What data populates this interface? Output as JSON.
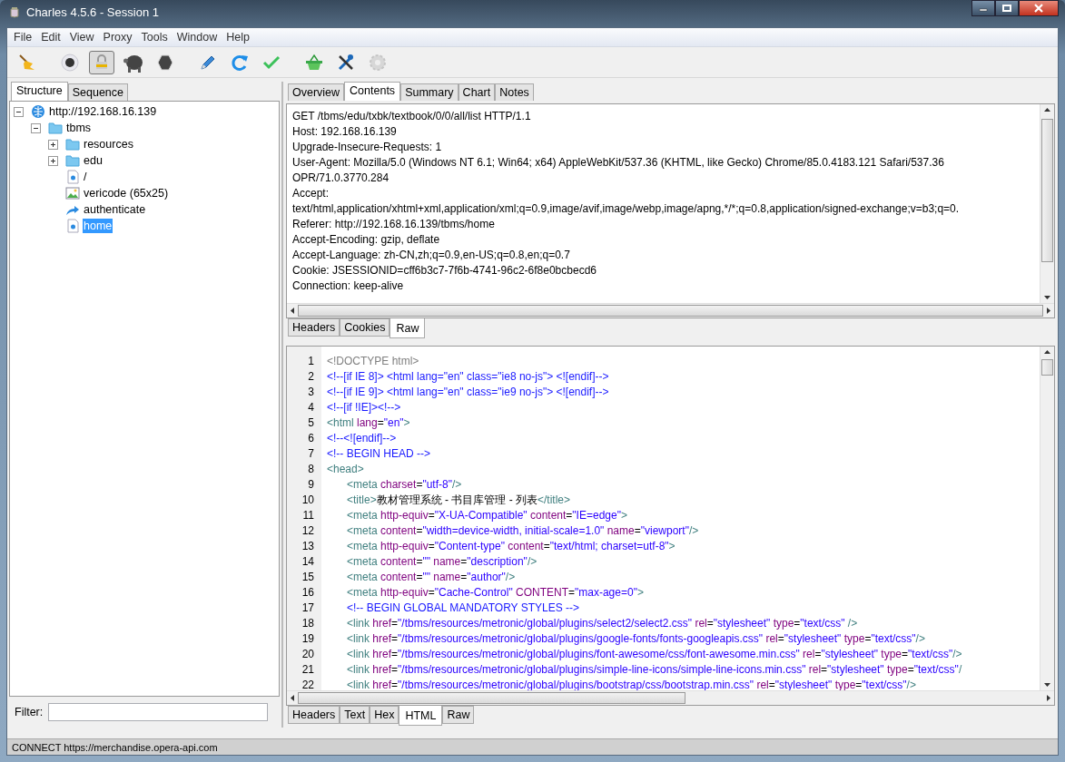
{
  "window": {
    "title": "Charles 4.5.6 - Session 1"
  },
  "menu": [
    "File",
    "Edit",
    "View",
    "Proxy",
    "Tools",
    "Window",
    "Help"
  ],
  "toolbar": [
    {
      "kind": "broom",
      "pressed": false,
      "disabled": false
    },
    {
      "kind": "record",
      "pressed": false,
      "disabled": false
    },
    {
      "kind": "lock",
      "pressed": true,
      "disabled": false
    },
    {
      "kind": "turtle",
      "pressed": false,
      "disabled": false
    },
    {
      "kind": "stop",
      "pressed": false,
      "disabled": false
    },
    {
      "kind": "pen",
      "pressed": false,
      "disabled": false
    },
    {
      "kind": "refresh",
      "pressed": false,
      "disabled": false
    },
    {
      "kind": "check",
      "pressed": false,
      "disabled": false
    },
    {
      "kind": "basket",
      "pressed": false,
      "disabled": false
    },
    {
      "kind": "tools",
      "pressed": false,
      "disabled": false
    },
    {
      "kind": "gear",
      "pressed": false,
      "disabled": true
    }
  ],
  "sidebar": {
    "tabs": [
      {
        "label": "Structure",
        "selected": true
      },
      {
        "label": "Sequence",
        "selected": false
      }
    ],
    "tree": [
      {
        "label": "http://192.168.16.139",
        "kind": "globe",
        "expanded": true,
        "selected": false,
        "children": [
          {
            "label": "tbms",
            "kind": "folder",
            "expanded": true,
            "selected": false,
            "children": [
              {
                "label": "resources",
                "kind": "folder",
                "expanded": false,
                "selected": false
              },
              {
                "label": "edu",
                "kind": "folder",
                "expanded": false,
                "selected": false
              },
              {
                "label": "/",
                "kind": "page",
                "selected": false
              },
              {
                "label": "vericode (65x25)",
                "kind": "image",
                "selected": false
              },
              {
                "label": "authenticate",
                "kind": "redirect",
                "selected": false
              },
              {
                "label": "home",
                "kind": "page",
                "selected": true
              }
            ]
          }
        ]
      }
    ],
    "filter": {
      "label": "Filter:"
    }
  },
  "detail": {
    "tabs": [
      {
        "label": "Overview",
        "selected": false
      },
      {
        "label": "Contents",
        "selected": true
      },
      {
        "label": "Summary",
        "selected": false
      },
      {
        "label": "Chart",
        "selected": false
      },
      {
        "label": "Notes",
        "selected": false
      }
    ],
    "request": {
      "lines": [
        "GET /tbms/edu/txbk/textbook/0/0/all/list HTTP/1.1",
        "Host: 192.168.16.139",
        "Upgrade-Insecure-Requests: 1",
        "User-Agent: Mozilla/5.0 (Windows NT 6.1; Win64; x64) AppleWebKit/537.36 (KHTML, like Gecko) Chrome/85.0.4183.121 Safari/537.36",
        "OPR/71.0.3770.284",
        "Accept:",
        "text/html,application/xhtml+xml,application/xml;q=0.9,image/avif,image/webp,image/apng,*/*;q=0.8,application/signed-exchange;v=b3;q=0.",
        "Referer: http://192.168.16.139/tbms/home",
        "Accept-Encoding: gzip, deflate",
        "Accept-Language: zh-CN,zh;q=0.9,en-US;q=0.8,en;q=0.7",
        "Cookie: JSESSIONID=cff6b3c7-7f6b-4741-96c2-6f8e0bcbecd6",
        "Connection: keep-alive"
      ],
      "tabs": [
        {
          "label": "Headers",
          "selected": false
        },
        {
          "label": "Cookies",
          "selected": false
        },
        {
          "label": "Raw",
          "selected": true
        }
      ]
    },
    "response": {
      "lines": [
        {
          "number": "1",
          "indent": false,
          "tokens": [
            {
              "kind": "doctype",
              "text": "<!DOCTYPE html>"
            }
          ]
        },
        {
          "number": "2",
          "indent": false,
          "tokens": [
            {
              "kind": "comment",
              "text": "<!--[if IE 8]> <html lang=\"en\" class=\"ie8 no-js\"> <![endif]-->"
            }
          ]
        },
        {
          "number": "3",
          "indent": false,
          "tokens": [
            {
              "kind": "comment",
              "text": "<!--[if IE 9]> <html lang=\"en\" class=\"ie9 no-js\"> <![endif]-->"
            }
          ]
        },
        {
          "number": "4",
          "indent": false,
          "tokens": [
            {
              "kind": "comment",
              "text": "<!--[if !IE]><!-->"
            }
          ]
        },
        {
          "number": "5",
          "indent": false,
          "tokens": [
            {
              "kind": "tag",
              "text": "<html"
            },
            {
              "kind": "attr",
              "text": " lang"
            },
            {
              "kind": "plain",
              "text": "="
            },
            {
              "kind": "value",
              "text": "\"en\""
            },
            {
              "kind": "tag",
              "text": ">"
            }
          ]
        },
        {
          "number": "6",
          "indent": false,
          "tokens": [
            {
              "kind": "comment",
              "text": "<!--<![endif]-->"
            }
          ]
        },
        {
          "number": "7",
          "indent": false,
          "tokens": [
            {
              "kind": "comment",
              "text": "<!-- BEGIN HEAD -->"
            }
          ]
        },
        {
          "number": "8",
          "indent": false,
          "tokens": [
            {
              "kind": "tag",
              "text": "<head>"
            }
          ]
        },
        {
          "number": "9",
          "indent": true,
          "tokens": [
            {
              "kind": "tag",
              "text": "<meta"
            },
            {
              "kind": "attr",
              "text": " charset"
            },
            {
              "kind": "plain",
              "text": "="
            },
            {
              "kind": "value",
              "text": "\"utf-8\""
            },
            {
              "kind": "tag",
              "text": "/>"
            }
          ]
        },
        {
          "number": "10",
          "indent": true,
          "tokens": [
            {
              "kind": "tag",
              "text": "<title>"
            },
            {
              "kind": "plain",
              "text": "教材管理系统 - 书目库管理 - 列表"
            },
            {
              "kind": "tag",
              "text": "</title>"
            }
          ]
        },
        {
          "number": "11",
          "indent": true,
          "tokens": [
            {
              "kind": "tag",
              "text": "<meta"
            },
            {
              "kind": "attr",
              "text": " http-equiv"
            },
            {
              "kind": "plain",
              "text": "="
            },
            {
              "kind": "value",
              "text": "\"X-UA-Compatible\""
            },
            {
              "kind": "attr",
              "text": " content"
            },
            {
              "kind": "plain",
              "text": "="
            },
            {
              "kind": "value",
              "text": "\"IE=edge\""
            },
            {
              "kind": "tag",
              "text": ">"
            }
          ]
        },
        {
          "number": "12",
          "indent": true,
          "tokens": [
            {
              "kind": "tag",
              "text": "<meta"
            },
            {
              "kind": "attr",
              "text": " content"
            },
            {
              "kind": "plain",
              "text": "="
            },
            {
              "kind": "value",
              "text": "\"width=device-width, initial-scale=1.0\""
            },
            {
              "kind": "attr",
              "text": " name"
            },
            {
              "kind": "plain",
              "text": "="
            },
            {
              "kind": "value",
              "text": "\"viewport\""
            },
            {
              "kind": "tag",
              "text": "/>"
            }
          ]
        },
        {
          "number": "13",
          "indent": true,
          "tokens": [
            {
              "kind": "tag",
              "text": "<meta"
            },
            {
              "kind": "attr",
              "text": " http-equiv"
            },
            {
              "kind": "plain",
              "text": "="
            },
            {
              "kind": "value",
              "text": "\"Content-type\""
            },
            {
              "kind": "attr",
              "text": " content"
            },
            {
              "kind": "plain",
              "text": "="
            },
            {
              "kind": "value",
              "text": "\"text/html; charset=utf-8\""
            },
            {
              "kind": "tag",
              "text": ">"
            }
          ]
        },
        {
          "number": "14",
          "indent": true,
          "tokens": [
            {
              "kind": "tag",
              "text": "<meta"
            },
            {
              "kind": "attr",
              "text": " content"
            },
            {
              "kind": "plain",
              "text": "="
            },
            {
              "kind": "value",
              "text": "\"\""
            },
            {
              "kind": "attr",
              "text": " name"
            },
            {
              "kind": "plain",
              "text": "="
            },
            {
              "kind": "value",
              "text": "\"description\""
            },
            {
              "kind": "tag",
              "text": "/>"
            }
          ]
        },
        {
          "number": "15",
          "indent": true,
          "tokens": [
            {
              "kind": "tag",
              "text": "<meta"
            },
            {
              "kind": "attr",
              "text": " content"
            },
            {
              "kind": "plain",
              "text": "="
            },
            {
              "kind": "value",
              "text": "\"\""
            },
            {
              "kind": "attr",
              "text": " name"
            },
            {
              "kind": "plain",
              "text": "="
            },
            {
              "kind": "value",
              "text": "\"author\""
            },
            {
              "kind": "tag",
              "text": "/>"
            }
          ]
        },
        {
          "number": "16",
          "indent": true,
          "tokens": [
            {
              "kind": "tag",
              "text": "<meta"
            },
            {
              "kind": "attr",
              "text": " http-equiv"
            },
            {
              "kind": "plain",
              "text": "="
            },
            {
              "kind": "value",
              "text": "\"Cache-Control\""
            },
            {
              "kind": "attr",
              "text": " CONTENT"
            },
            {
              "kind": "plain",
              "text": "="
            },
            {
              "kind": "value",
              "text": "\"max-age=0\""
            },
            {
              "kind": "tag",
              "text": ">"
            }
          ]
        },
        {
          "number": "17",
          "indent": true,
          "tokens": [
            {
              "kind": "comment",
              "text": "<!-- BEGIN GLOBAL MANDATORY STYLES -->"
            }
          ]
        },
        {
          "number": "18",
          "indent": true,
          "tokens": [
            {
              "kind": "tag",
              "text": "<link"
            },
            {
              "kind": "attr",
              "text": " href"
            },
            {
              "kind": "plain",
              "text": "="
            },
            {
              "kind": "value",
              "text": "\"/tbms/resources/metronic/global/plugins/select2/select2.css\""
            },
            {
              "kind": "attr",
              "text": " rel"
            },
            {
              "kind": "plain",
              "text": "="
            },
            {
              "kind": "value",
              "text": "\"stylesheet\""
            },
            {
              "kind": "attr",
              "text": " type"
            },
            {
              "kind": "plain",
              "text": "="
            },
            {
              "kind": "value",
              "text": "\"text/css\""
            },
            {
              "kind": "tag",
              "text": " />"
            }
          ]
        },
        {
          "number": "19",
          "indent": true,
          "tokens": [
            {
              "kind": "tag",
              "text": "<link"
            },
            {
              "kind": "attr",
              "text": " href"
            },
            {
              "kind": "plain",
              "text": "="
            },
            {
              "kind": "value",
              "text": "\"/tbms/resources/metronic/global/plugins/google-fonts/fonts-googleapis.css\""
            },
            {
              "kind": "attr",
              "text": " rel"
            },
            {
              "kind": "plain",
              "text": "="
            },
            {
              "kind": "value",
              "text": "\"stylesheet\""
            },
            {
              "kind": "attr",
              "text": " type"
            },
            {
              "kind": "plain",
              "text": "="
            },
            {
              "kind": "value",
              "text": "\"text/css\""
            },
            {
              "kind": "tag",
              "text": "/>"
            }
          ]
        },
        {
          "number": "20",
          "indent": true,
          "tokens": [
            {
              "kind": "tag",
              "text": "<link"
            },
            {
              "kind": "attr",
              "text": " href"
            },
            {
              "kind": "plain",
              "text": "="
            },
            {
              "kind": "value",
              "text": "\"/tbms/resources/metronic/global/plugins/font-awesome/css/font-awesome.min.css\""
            },
            {
              "kind": "attr",
              "text": " rel"
            },
            {
              "kind": "plain",
              "text": "="
            },
            {
              "kind": "value",
              "text": "\"stylesheet\""
            },
            {
              "kind": "attr",
              "text": " type"
            },
            {
              "kind": "plain",
              "text": "="
            },
            {
              "kind": "value",
              "text": "\"text/css\""
            },
            {
              "kind": "tag",
              "text": "/>"
            }
          ]
        },
        {
          "number": "21",
          "indent": true,
          "tokens": [
            {
              "kind": "tag",
              "text": "<link"
            },
            {
              "kind": "attr",
              "text": " href"
            },
            {
              "kind": "plain",
              "text": "="
            },
            {
              "kind": "value",
              "text": "\"/tbms/resources/metronic/global/plugins/simple-line-icons/simple-line-icons.min.css\""
            },
            {
              "kind": "attr",
              "text": " rel"
            },
            {
              "kind": "plain",
              "text": "="
            },
            {
              "kind": "value",
              "text": "\"stylesheet\""
            },
            {
              "kind": "attr",
              "text": " type"
            },
            {
              "kind": "plain",
              "text": "="
            },
            {
              "kind": "value",
              "text": "\"text/css\""
            },
            {
              "kind": "tag",
              "text": "/"
            }
          ]
        },
        {
          "number": "22",
          "indent": true,
          "tokens": [
            {
              "kind": "tag",
              "text": "<link"
            },
            {
              "kind": "attr",
              "text": " href"
            },
            {
              "kind": "plain",
              "text": "="
            },
            {
              "kind": "value",
              "text": "\"/tbms/resources/metronic/global/plugins/bootstrap/css/bootstrap.min.css\""
            },
            {
              "kind": "attr",
              "text": " rel"
            },
            {
              "kind": "plain",
              "text": "="
            },
            {
              "kind": "value",
              "text": "\"stylesheet\""
            },
            {
              "kind": "attr",
              "text": " type"
            },
            {
              "kind": "plain",
              "text": "="
            },
            {
              "kind": "value",
              "text": "\"text/css\""
            },
            {
              "kind": "tag",
              "text": "/>"
            }
          ]
        }
      ],
      "tabs": [
        {
          "label": "Headers",
          "selected": false
        },
        {
          "label": "Text",
          "selected": false
        },
        {
          "label": "Hex",
          "selected": false
        },
        {
          "label": "HTML",
          "selected": true
        },
        {
          "label": "Raw",
          "selected": false
        }
      ]
    }
  },
  "status_bar": "CONNECT https://merchandise.opera-api.com"
}
